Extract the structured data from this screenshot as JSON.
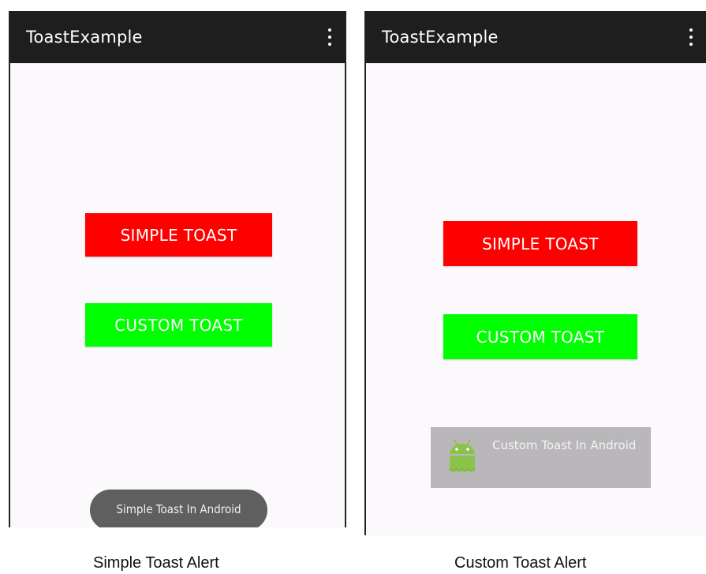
{
  "app_title": "ToastExample",
  "left_screen": {
    "simple_button": "SIMPLE TOAST",
    "custom_button": "CUSTOM TOAST",
    "toast_message": "Simple Toast In Android",
    "caption": "Simple Toast Alert"
  },
  "right_screen": {
    "simple_button": "SIMPLE TOAST",
    "custom_button": "CUSTOM TOAST",
    "toast_message": "Custom Toast In Android",
    "toast_icon": "android-robot-icon",
    "caption": "Custom Toast Alert"
  },
  "colors": {
    "appbar": "#1e1e1e",
    "simple_button": "#ff0000",
    "custom_button": "#00ff00",
    "custom_toast_bg": "#b9b7ba",
    "simple_toast_bg": "#5f5f5f",
    "android_green": "#8bc34a"
  },
  "icons": {
    "overflow_menu": "overflow-menu-icon"
  }
}
